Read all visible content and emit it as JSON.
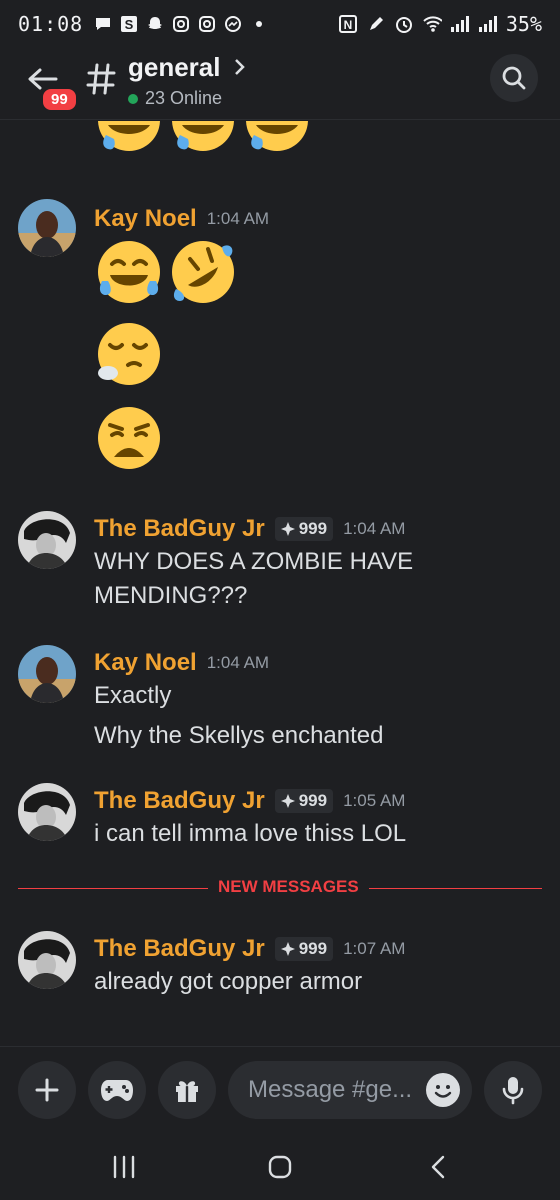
{
  "status_bar": {
    "time": "01:08",
    "battery": "35%",
    "icons": [
      "chat-bubble-icon",
      "s-app-icon",
      "snapchat-icon",
      "instagram-icon",
      "instagram-icon",
      "messenger-icon",
      "dot-icon",
      "nfc-icon",
      "pen-icon",
      "alarm-icon",
      "wifi-icon",
      "signal-icon",
      "signal-icon"
    ]
  },
  "header": {
    "unread_badge": "99",
    "channel": "general",
    "online": "23 Online"
  },
  "messages": [
    {
      "author": "Kay Noel",
      "time": "1:04 AM",
      "lines": []
    },
    {
      "author": "The BadGuy Jr",
      "tag": "999",
      "time": "1:04 AM",
      "lines": [
        "WHY DOES A ZOMBIE HAVE MENDING???"
      ]
    },
    {
      "author": "Kay Noel",
      "time": "1:04 AM",
      "lines": [
        "Exactly",
        "Why the Skellys enchanted"
      ]
    },
    {
      "author": "The BadGuy Jr",
      "tag": "999",
      "time": "1:05 AM",
      "lines": [
        "i can tell imma love thiss LOL"
      ]
    },
    {
      "author": "The BadGuy Jr",
      "tag": "999",
      "time": "1:07 AM",
      "lines": [
        "already got copper armor"
      ]
    }
  ],
  "divider_label": "NEW MESSAGES",
  "composer": {
    "placeholder": "Message #ge..."
  },
  "colors": {
    "background": "#1e1f22",
    "author_orange": "#f0a232",
    "new_messages_red": "#f23f43",
    "online_green": "#23a55a"
  }
}
